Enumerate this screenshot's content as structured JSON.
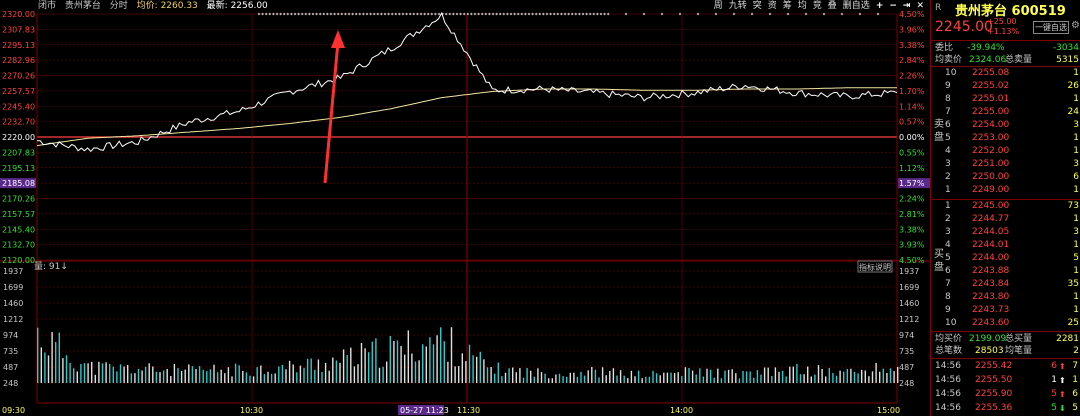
{
  "header": {
    "market_status": "闭市",
    "stock_short": "贵州茅台",
    "mode": "分时",
    "avg_label": "均价: 2260.33",
    "last_label": "最新: 2256.00"
  },
  "toolbar": [
    "周",
    "九转",
    "突",
    "资",
    "筹",
    "均",
    "竞",
    "叠",
    "删自选",
    "+",
    "−",
    "⇥",
    "✕"
  ],
  "price_axis": {
    "left": [
      "2320.00",
      "2307.83",
      "2295.13",
      "2282.96",
      "2270.26",
      "2257.57",
      "2245.40",
      "2232.70",
      "2220.00",
      "2207.83",
      "2195.13",
      "2185.08",
      "2170.26",
      "2157.57",
      "2145.40",
      "2132.70",
      "2120.00"
    ],
    "right": [
      "4.50%",
      "3.96%",
      "3.38%",
      "2.84%",
      "2.26%",
      "1.70%",
      "1.14%",
      "0.57%",
      "0.00%",
      "0.55%",
      "1.12%",
      "1.57%",
      "2.24%",
      "2.81%",
      "3.38%",
      "3.93%",
      "4.50%"
    ],
    "highlight_left": "2185.08",
    "highlight_right": "1.57%"
  },
  "volume": {
    "label": "量: 91↓",
    "indicator_button": "指标说明",
    "axis": [
      "1937",
      "1699",
      "1460",
      "1212",
      "974",
      "735",
      "487",
      "248"
    ]
  },
  "time_axis": [
    "09:30",
    "10:30",
    "05-27 11:23",
    "11:30",
    "14:00",
    "15:00"
  ],
  "colors": {
    "price_line": "#ffffff",
    "avg_line": "#f0e6a0",
    "grid": "#800000",
    "volume_up": "#30c8c8",
    "volume_down": "#e0e0e0",
    "arrow": "#ff3030"
  },
  "chart_data": {
    "type": "line",
    "x": [
      "09:30",
      "09:45",
      "10:00",
      "10:15",
      "10:30",
      "10:45",
      "11:00",
      "11:15",
      "11:23",
      "11:30",
      "13:15",
      "13:30",
      "13:45",
      "14:00",
      "14:15",
      "14:30",
      "14:45",
      "15:00"
    ],
    "series": [
      {
        "values": [
          2217,
          2210,
          2216,
          2232,
          2241,
          2257,
          2268,
          2292,
          2319,
          2258,
          2259,
          2256,
          2252,
          2256,
          2262,
          2256,
          2253,
          2256
        ]
      },
      {
        "values": [
          2213,
          2219,
          2221,
          2224,
          2227,
          2231,
          2236,
          2243,
          2252,
          2257,
          2259,
          2259,
          2258,
          2258,
          2259,
          2259,
          2260,
          2260
        ]
      }
    ],
    "ylim": [
      2120.0,
      2320.0
    ],
    "volume": [
      1100,
      360,
      320,
      280,
      300,
      360,
      520,
      760,
      974,
      320,
      220,
      260,
      180,
      260,
      200,
      300,
      240,
      350
    ]
  },
  "quote": {
    "r_label": "R",
    "title": "贵州茅台 600519",
    "price": "2245.00",
    "change": "+25.00",
    "change_pct": "+1.13%",
    "order_button": "一键自选",
    "weibi_label": "委比",
    "weibi": "-39.94%",
    "weicha": "-3034",
    "ask_avg_label": "均卖价",
    "ask_avg": "2324.06",
    "ask_total_label": "总卖量",
    "ask_total": "5315",
    "sell_side": "卖盘",
    "asks": [
      {
        "lv": "10",
        "p": "2255.08",
        "v": "1"
      },
      {
        "lv": "9",
        "p": "2255.02",
        "v": "26"
      },
      {
        "lv": "8",
        "p": "2255.01",
        "v": "1"
      },
      {
        "lv": "7",
        "p": "2255.00",
        "v": "24"
      },
      {
        "lv": "6",
        "p": "2254.00",
        "v": "3"
      },
      {
        "lv": "5",
        "p": "2253.00",
        "v": "1"
      },
      {
        "lv": "4",
        "p": "2252.00",
        "v": "1"
      },
      {
        "lv": "3",
        "p": "2251.00",
        "v": "3"
      },
      {
        "lv": "2",
        "p": "2250.00",
        "v": "6"
      },
      {
        "lv": "1",
        "p": "2249.00",
        "v": "1"
      }
    ],
    "buy_side": "买盘",
    "bids": [
      {
        "lv": "1",
        "p": "2245.00",
        "v": "73"
      },
      {
        "lv": "2",
        "p": "2244.77",
        "v": "1"
      },
      {
        "lv": "3",
        "p": "2244.05",
        "v": "3"
      },
      {
        "lv": "4",
        "p": "2244.01",
        "v": "1"
      },
      {
        "lv": "5",
        "p": "2244.00",
        "v": "5"
      },
      {
        "lv": "6",
        "p": "2243.88",
        "v": "1"
      },
      {
        "lv": "7",
        "p": "2243.84",
        "v": "35"
      },
      {
        "lv": "8",
        "p": "2243.80",
        "v": "1"
      },
      {
        "lv": "9",
        "p": "2243.73",
        "v": "1"
      },
      {
        "lv": "10",
        "p": "2243.60",
        "v": "25"
      }
    ],
    "bid_avg_label": "均买价",
    "bid_avg": "2199.09",
    "bid_total_label": "总买量",
    "bid_total": "2281",
    "trades_label": "总笔数",
    "trades": "28503",
    "avg_trade_label": "均笔量",
    "avg_trade": "2",
    "ticks": [
      {
        "t": "14:56",
        "p": "2255.42",
        "v": "6",
        "dir": "up",
        "n": "7"
      },
      {
        "t": "14:56",
        "p": "2255.50",
        "v": "1",
        "dir": "up_w",
        "n": "1"
      },
      {
        "t": "14:56",
        "p": "2255.90",
        "v": "5",
        "dir": "up",
        "n": "6"
      },
      {
        "t": "14:56",
        "p": "2255.36",
        "v": "5",
        "dir": "down",
        "n": "5"
      }
    ]
  }
}
